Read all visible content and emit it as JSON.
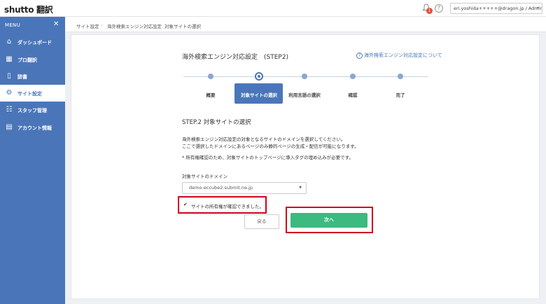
{
  "header": {
    "logo": "shutto 翻訳",
    "notification_count": "1",
    "help_glyph": "?",
    "account": "eri.yoshida+++++@dragon.jp / Admin"
  },
  "sidebar": {
    "menu_label": "MENU",
    "items": [
      {
        "label": "ダッシュボード",
        "icon": "home-icon"
      },
      {
        "label": "プロ翻訳",
        "icon": "grid-icon"
      },
      {
        "label": "辞書",
        "icon": "book-icon"
      },
      {
        "label": "サイト設定",
        "icon": "gear-icon",
        "active": true
      },
      {
        "label": "スタッフ管理",
        "icon": "people-icon"
      },
      {
        "label": "アカウント情報",
        "icon": "document-icon"
      }
    ]
  },
  "breadcrumb": [
    "サイト設定",
    "海外検索エンジン対応設定",
    "対象サイトの選択"
  ],
  "page": {
    "title": "海外検索エンジン対応設定　(STEP2)",
    "help_link": "海外検索エンジン対応設定について"
  },
  "steps": [
    {
      "label": "概要"
    },
    {
      "label": "対象サイトの選択",
      "active": true
    },
    {
      "label": "利用言語の選択"
    },
    {
      "label": "確認"
    },
    {
      "label": "完了"
    }
  ],
  "section": {
    "title": "STEP.2 対象サイトの選択",
    "desc1": "海外検索エンジン対応設定の対象となるサイトのドメインを選択してください。",
    "desc2": "ここで選択したドメインにあるページのみ静的ページの生成・配信が可能になります。",
    "note": "* 所有権確認のため、対象サイトのトップページに導入タグの埋め込みが必要です。"
  },
  "form": {
    "domain_label": "対象サイトのドメイン",
    "domain_value": "demo-eccube2.submit.ne.jp",
    "confirm_message": "サイトの所有権が確認できました。"
  },
  "buttons": {
    "back": "戻る",
    "next": "次へ"
  },
  "colors": {
    "sidebar": "#4a76b9",
    "next_button": "#3cba7f",
    "highlight": "#d0021b"
  }
}
